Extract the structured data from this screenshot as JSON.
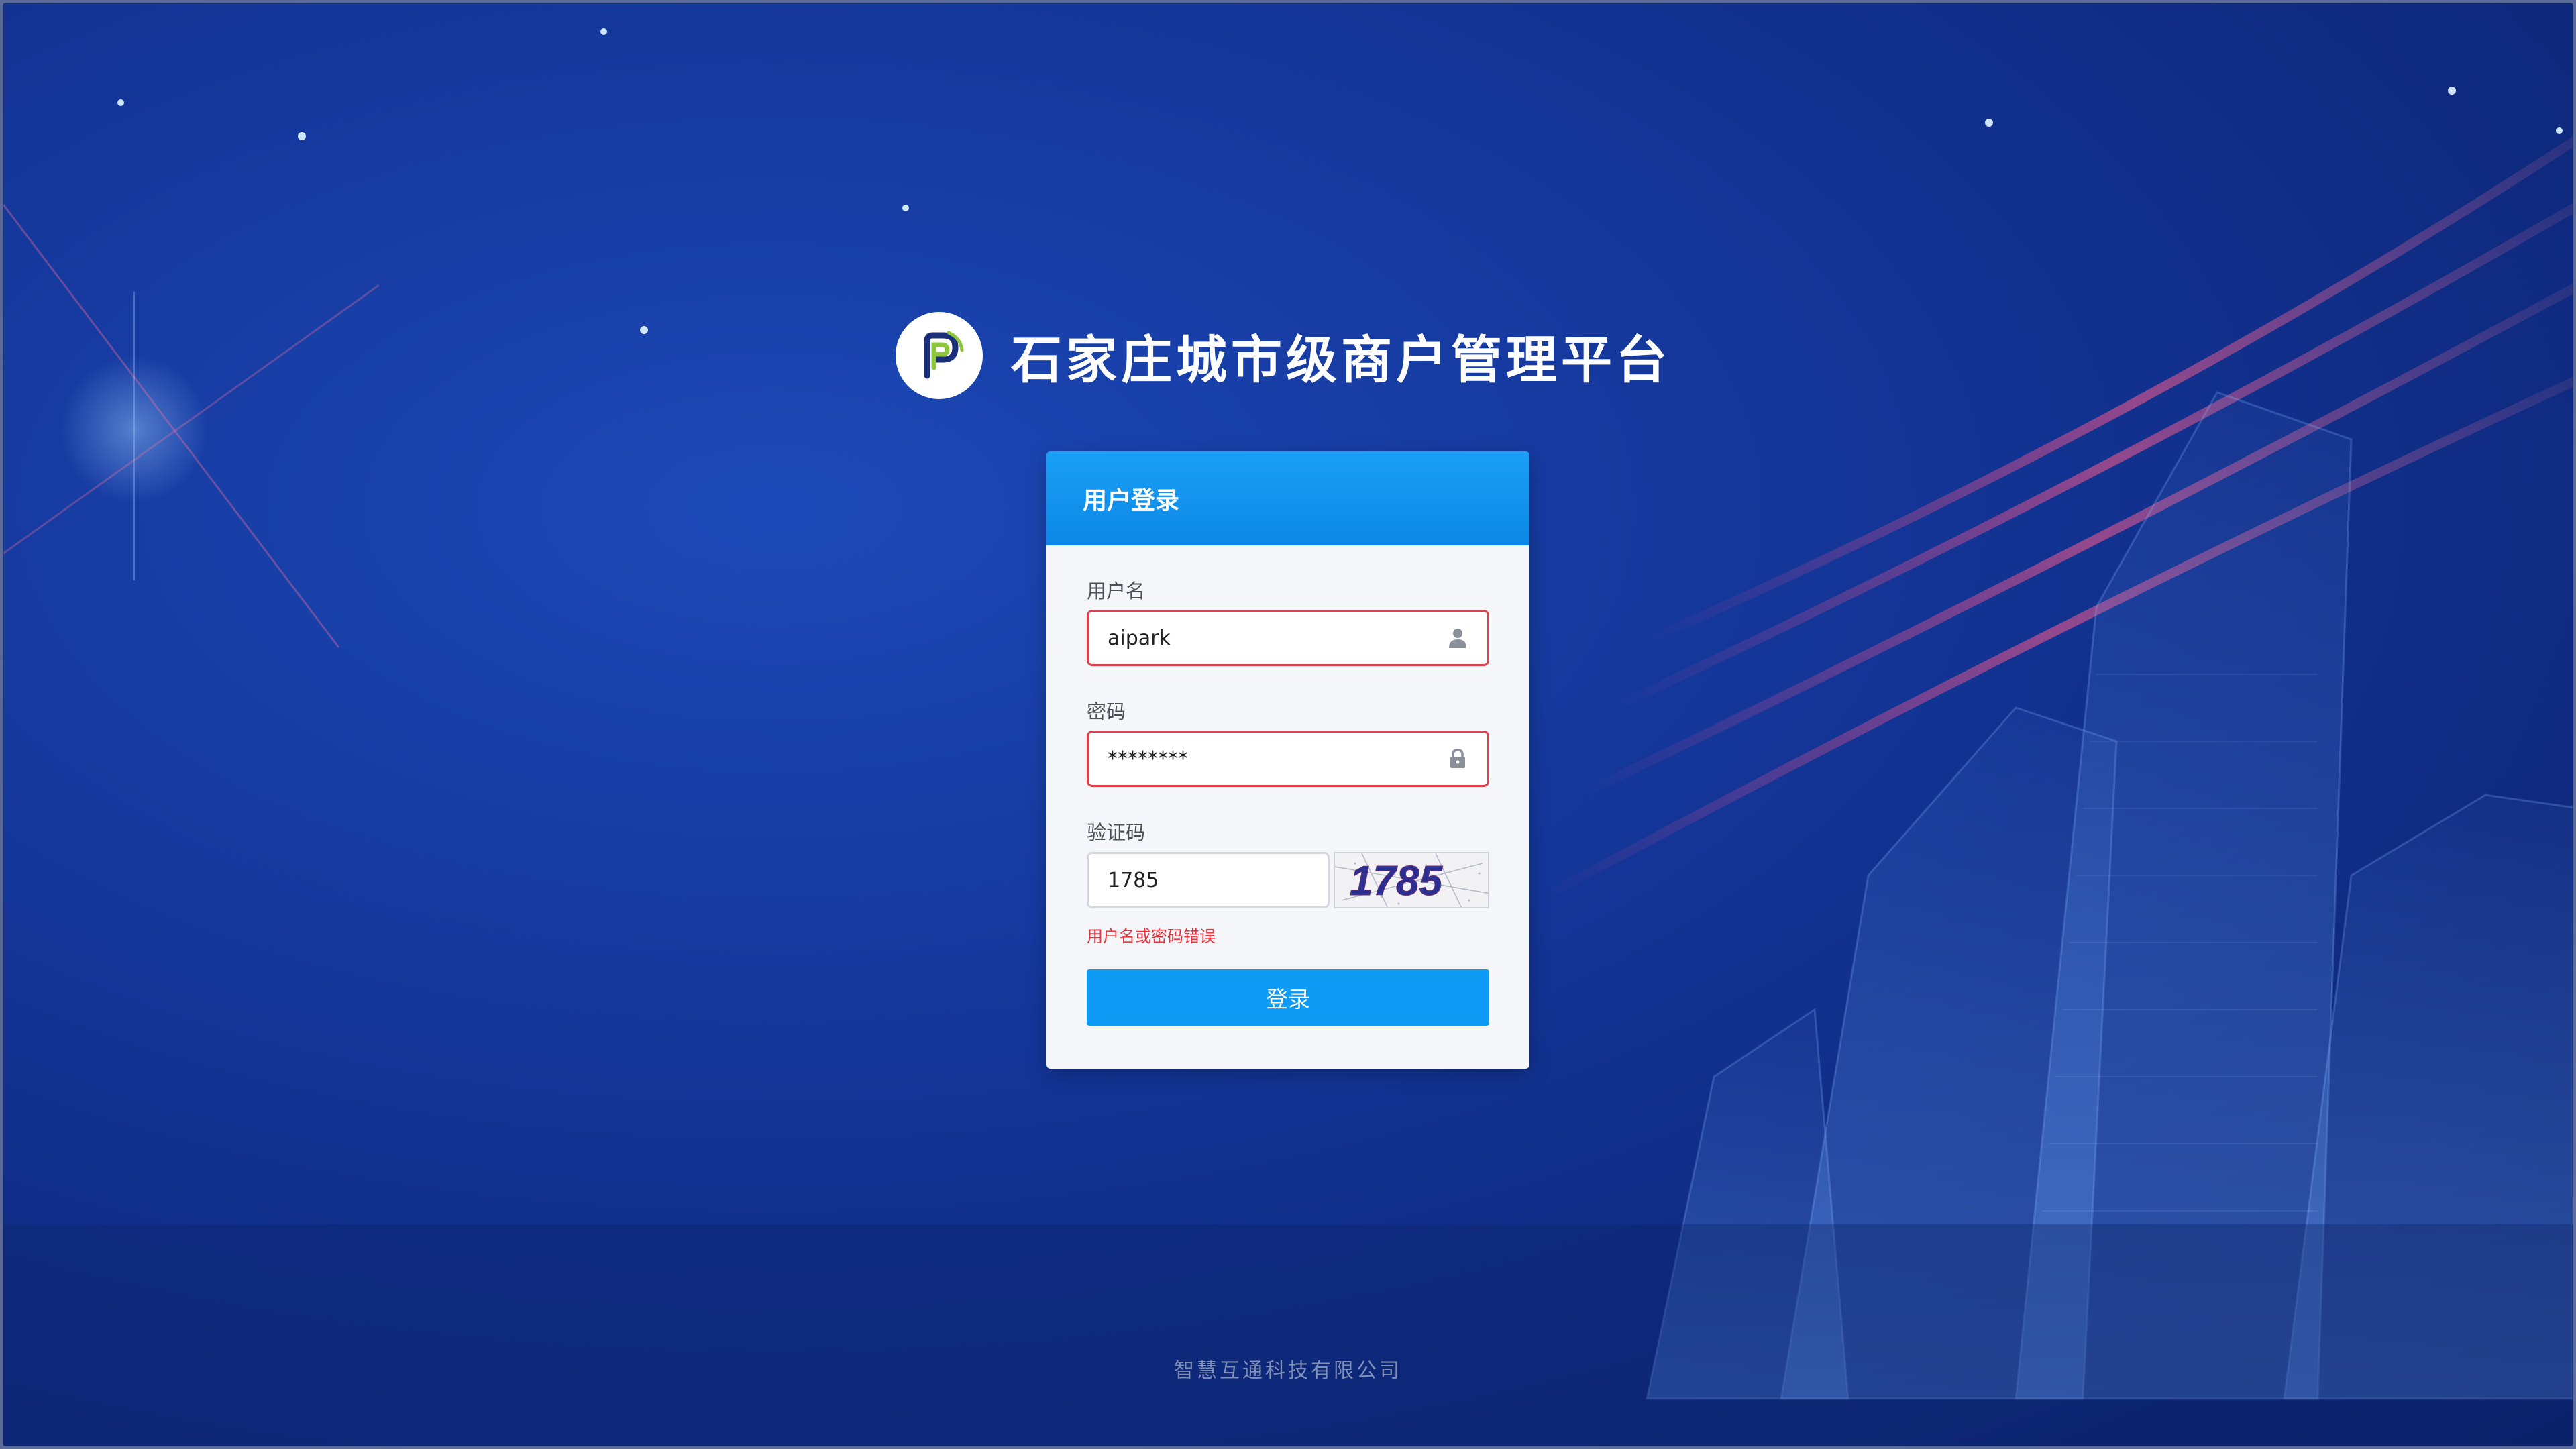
{
  "brand": {
    "title": "石家庄城市级商户管理平台",
    "logo_icon": "parking-p-logo-icon"
  },
  "login": {
    "header": "用户登录",
    "username": {
      "label": "用户名",
      "value": "aipark",
      "icon": "user-icon"
    },
    "password": {
      "label": "密码",
      "value": "********",
      "icon": "lock-icon"
    },
    "captcha": {
      "label": "验证码",
      "value": "1785",
      "image_text": "1785"
    },
    "error": "用户名或密码错误",
    "submit_label": "登录"
  },
  "footer": {
    "company": "智慧互通科技有限公司"
  },
  "colors": {
    "accent": "#0e9bf5",
    "error": "#e8323c",
    "background": "#15389d"
  }
}
